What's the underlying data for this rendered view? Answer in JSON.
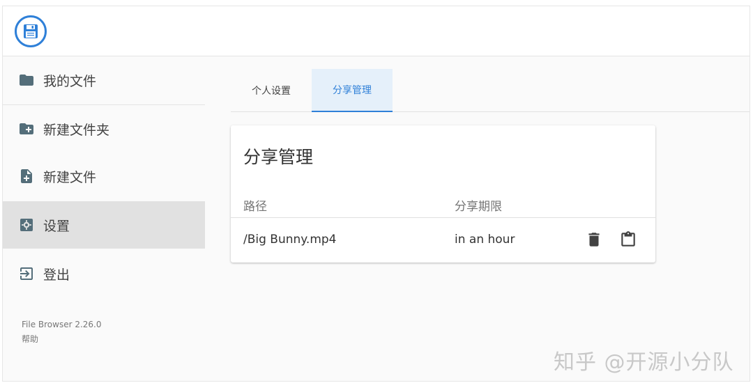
{
  "header": {
    "logo_icon": "floppy-disk-icon"
  },
  "sidebar": {
    "items": [
      {
        "label": "我的文件",
        "icon": "folder-icon"
      },
      {
        "label": "新建文件夹",
        "icon": "new-folder-icon"
      },
      {
        "label": "新建文件",
        "icon": "new-file-icon"
      },
      {
        "label": "设置",
        "icon": "settings-icon",
        "active": true
      },
      {
        "label": "登出",
        "icon": "logout-icon"
      }
    ],
    "footer": {
      "version": "File Browser 2.26.0",
      "help": "帮助"
    }
  },
  "tabs": [
    {
      "label": "个人设置",
      "active": false
    },
    {
      "label": "分享管理",
      "active": true
    }
  ],
  "share_card": {
    "title": "分享管理",
    "columns": {
      "path": "路径",
      "expires": "分享期限"
    },
    "rows": [
      {
        "path": "/Big Bunny.mp4",
        "expires": "in an hour"
      }
    ]
  },
  "watermark": "知乎 @开源小分队",
  "colors": {
    "accent": "#2f80d8",
    "active_tab_bg": "#e5f0fa",
    "active_nav_bg": "#e1e1e1"
  }
}
